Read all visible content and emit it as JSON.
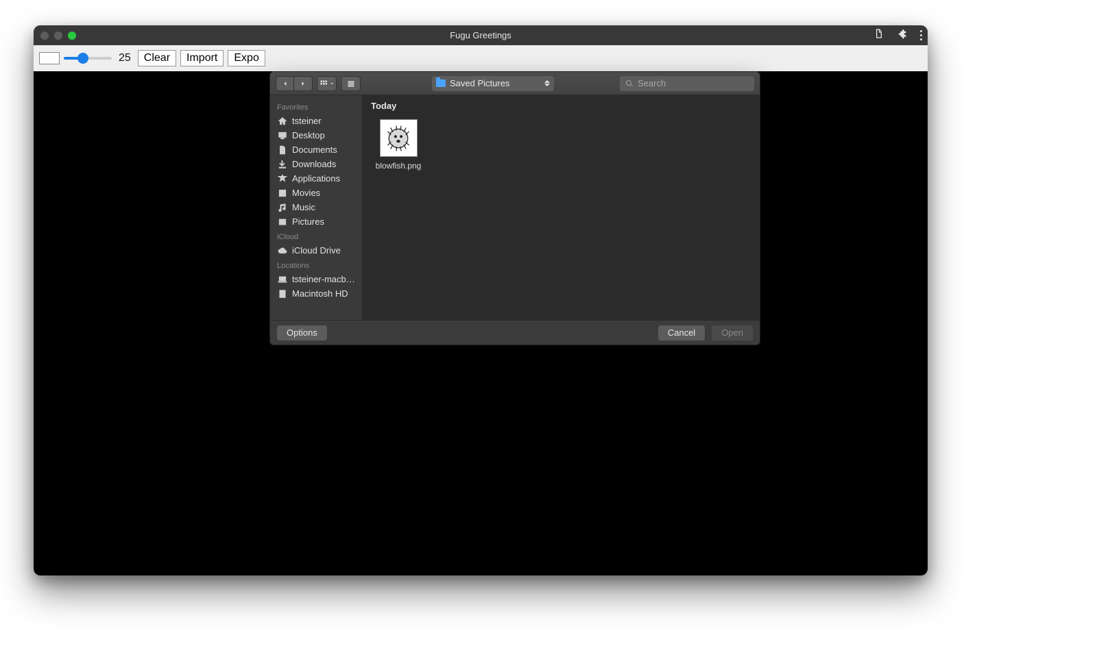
{
  "window": {
    "title": "Fugu Greetings"
  },
  "toolbar": {
    "slider_value": "25",
    "buttons": {
      "clear": "Clear",
      "import": "Import",
      "export": "Expo"
    }
  },
  "dialog": {
    "path_selector": "Saved Pictures",
    "search_placeholder": "Search",
    "sidebar": {
      "sections": [
        {
          "header": "Favorites",
          "items": [
            {
              "icon": "home",
              "label": "tsteiner"
            },
            {
              "icon": "desktop",
              "label": "Desktop"
            },
            {
              "icon": "doc",
              "label": "Documents"
            },
            {
              "icon": "download",
              "label": "Downloads"
            },
            {
              "icon": "apps",
              "label": "Applications"
            },
            {
              "icon": "movie",
              "label": "Movies"
            },
            {
              "icon": "music",
              "label": "Music"
            },
            {
              "icon": "pictures",
              "label": "Pictures"
            }
          ]
        },
        {
          "header": "iCloud",
          "items": [
            {
              "icon": "cloud",
              "label": "iCloud Drive"
            }
          ]
        },
        {
          "header": "Locations",
          "items": [
            {
              "icon": "laptop",
              "label": "tsteiner-macb…"
            },
            {
              "icon": "disk",
              "label": "Macintosh HD"
            }
          ]
        }
      ]
    },
    "content": {
      "group_header": "Today",
      "files": [
        {
          "name": "blowfish.png"
        }
      ]
    },
    "footer": {
      "options": "Options",
      "cancel": "Cancel",
      "open": "Open"
    }
  }
}
